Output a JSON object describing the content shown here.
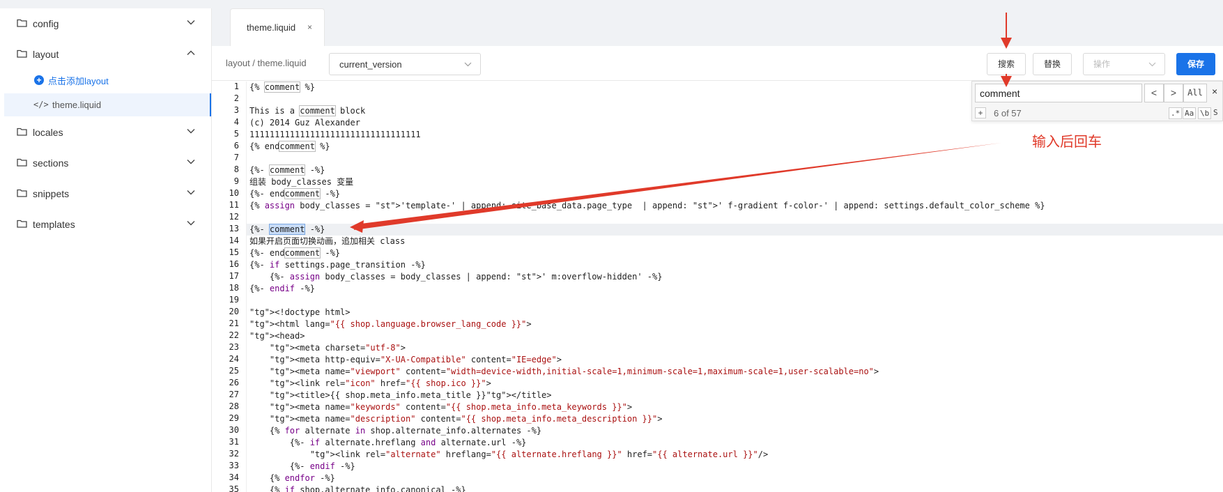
{
  "sidebar": {
    "folders": [
      {
        "label": "config"
      },
      {
        "label": "layout"
      },
      {
        "label": "locales"
      },
      {
        "label": "sections"
      },
      {
        "label": "snippets"
      },
      {
        "label": "templates"
      }
    ],
    "add_link": "点击添加layout",
    "active_file": "theme.liquid"
  },
  "tabs": [
    {
      "label": "theme.liquid",
      "close": "×"
    }
  ],
  "toolbar": {
    "breadcrumb": "layout / theme.liquid",
    "version_select": "current_version",
    "search_label": "搜索",
    "replace_label": "替换",
    "ops_placeholder": "操作",
    "save_label": "保存"
  },
  "search_panel": {
    "query": "comment",
    "prev": "<",
    "next": ">",
    "all": "All",
    "close": "×",
    "plus": "+",
    "count": "6 of 57",
    "opt_regex": ".*",
    "opt_case": "Aa",
    "opt_word": "\\b",
    "opt_selection": "S"
  },
  "annotation": {
    "text": "输入后回车",
    "color": "#e03a2a"
  },
  "editor": {
    "current_line": 13,
    "line_numbers": [
      "1",
      "2",
      "3",
      "4",
      "5",
      "6",
      "7",
      "8",
      "9",
      "10",
      "11",
      "12",
      "13",
      "14",
      "15",
      "16",
      "17",
      "18",
      "19",
      "20",
      "21",
      "22",
      "23",
      "24",
      "25",
      "26",
      "27",
      "28",
      "29",
      "30",
      "31",
      "32",
      "33",
      "34",
      "35"
    ],
    "lines": [
      "{% comment %}",
      "",
      "This is a comment block",
      "(c) 2014 Guz Alexander",
      "1111111111111111111111111111111111",
      "{% endcomment %}",
      "",
      "{%- comment -%}",
      "组装 body_classes 变量",
      "{%- endcomment -%}",
      "{% assign body_classes = 'template-' | append: site_base_data.page_type  | append: ' f-gradient f-color-' | append: settings.default_color_scheme %}",
      "",
      "{%- comment -%}",
      "如果开启页面切换动画，追加相关 class",
      "{%- endcomment -%}",
      "{%- if settings.page_transition -%}",
      "    {%- assign body_classes = body_classes | append: ' m:overflow-hidden' -%}",
      "{%- endif -%}",
      "",
      "<!doctype html>",
      "<html lang=\"{{ shop.language.browser_lang_code }}\">",
      "<head>",
      "    <meta charset=\"utf-8\">",
      "    <meta http-equiv=\"X-UA-Compatible\" content=\"IE=edge\">",
      "    <meta name=\"viewport\" content=\"width=device-width,initial-scale=1,minimum-scale=1,maximum-scale=1,user-scalable=no\">",
      "    <link rel=\"icon\" href=\"{{ shop.ico }}\">",
      "    <title>{{ shop.meta_info.meta_title }}</title>",
      "    <meta name=\"keywords\" content=\"{{ shop.meta_info.meta_keywords }}\">",
      "    <meta name=\"description\" content=\"{{ shop.meta_info.meta_description }}\">",
      "    {% for alternate in shop.alternate_info.alternates -%}",
      "        {%- if alternate.hreflang and alternate.url -%}",
      "            <link rel=\"alternate\" hreflang=\"{{ alternate.hreflang }}\" href=\"{{ alternate.url }}\"/>",
      "        {%- endif -%}",
      "    {% endfor -%}",
      "    {% if shop.alternate_info.canonical -%}"
    ]
  }
}
